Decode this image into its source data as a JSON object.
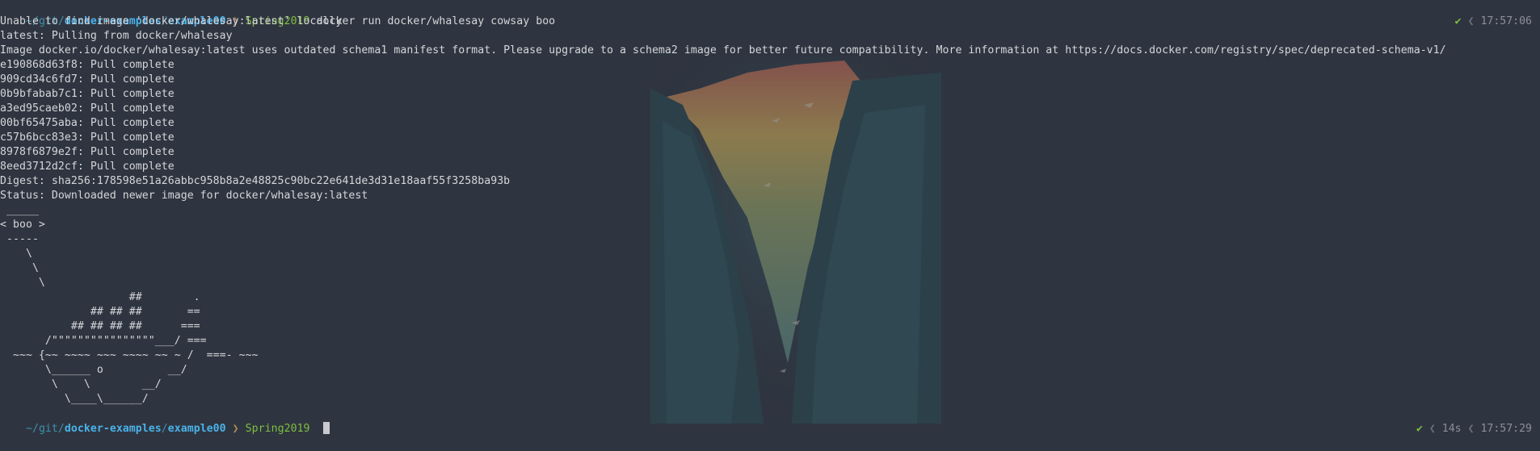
{
  "prompt_top": {
    "path_prefix": "~/git/",
    "path_repo": "docker-examples",
    "path_sep": "/",
    "path_dir": "example00",
    "sep_glyph": "❯",
    "branch": "Spring2019",
    "command": "docker run docker/whalesay cowsay boo"
  },
  "status_top": {
    "check": "✔",
    "sep": "❮",
    "time": "17:57:06"
  },
  "output_lines": [
    "Unable to find image 'docker/whalesay:latest' locally",
    "latest: Pulling from docker/whalesay",
    "Image docker.io/docker/whalesay:latest uses outdated schema1 manifest format. Please upgrade to a schema2 image for better future compatibility. More information at https://docs.docker.com/registry/spec/deprecated-schema-v1/",
    "e190868d63f8: Pull complete",
    "909cd34c6fd7: Pull complete",
    "0b9bfabab7c1: Pull complete",
    "a3ed95caeb02: Pull complete",
    "00bf65475aba: Pull complete",
    "c57b6bcc83e3: Pull complete",
    "8978f6879e2f: Pull complete",
    "8eed3712d2cf: Pull complete",
    "Digest: sha256:178598e51a26abbc958b8a2e48825c90bc22e641de3d31e18aaf55f3258ba93b",
    "Status: Downloaded newer image for docker/whalesay:latest",
    " _____",
    "< boo >",
    " -----",
    "    \\",
    "     \\",
    "      \\",
    "                    ##        .",
    "              ## ## ##       ==",
    "           ## ## ## ##      ===",
    "       /\"\"\"\"\"\"\"\"\"\"\"\"\"\"\"\"___/ ===",
    "  ~~~ {~~ ~~~~ ~~~ ~~~~ ~~ ~ /  ===- ~~~",
    "       \\______ o          __/",
    "        \\    \\        __/",
    "          \\____\\______/"
  ],
  "prompt_bottom": {
    "path_prefix": "~/git/",
    "path_repo": "docker-examples",
    "path_sep": "/",
    "path_dir": "example00",
    "sep_glyph": "❯",
    "branch": "Spring2019"
  },
  "status_bottom": {
    "check": "✔",
    "sep1": "❮",
    "duration": "14s",
    "sep2": "❮",
    "time": "17:57:29"
  },
  "colors": {
    "background": "#2f3540",
    "text": "#d4d6da",
    "path": "#4ab2ea",
    "branch": "#7fbf3f",
    "check": "#7fbf3f"
  }
}
